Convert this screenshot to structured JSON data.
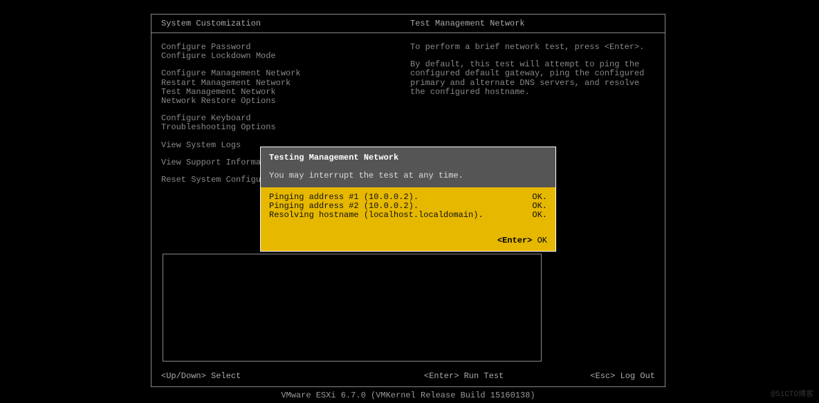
{
  "header": {
    "left": "System Customization",
    "right": "Test Management Network"
  },
  "menu": {
    "group1": [
      "Configure Password",
      "Configure Lockdown Mode"
    ],
    "group2": [
      "Configure Management Network",
      "Restart Management Network",
      "Test Management Network",
      "Network Restore Options"
    ],
    "group3": [
      "Configure Keyboard",
      "Troubleshooting Options"
    ],
    "group4": [
      "View System Logs"
    ],
    "group5": [
      "View Support Information"
    ],
    "group6": [
      "Reset System Configuration"
    ]
  },
  "description": {
    "p1": "To perform a brief network test, press <Enter>.",
    "p2": "By default, this test will attempt to ping the configured default gateway, ping the configured primary and alternate DNS servers, and resolve the configured hostname."
  },
  "dialog": {
    "title": "Testing Management Network",
    "subtitle": "You may interrupt the test at any time.",
    "results": [
      {
        "label": "Pinging address #1 (10.0.0.2).",
        "status": "OK."
      },
      {
        "label": "Pinging address #2 (10.0.0.2).",
        "status": "OK."
      },
      {
        "label": "Resolving hostname (localhost.localdomain).",
        "status": "OK."
      }
    ],
    "footer_key": "<Enter>",
    "footer_action": "OK"
  },
  "footer": {
    "left": "<Up/Down> Select",
    "center": "<Enter> Run Test",
    "right": "<Esc> Log Out"
  },
  "version": "VMware ESXi 6.7.0 (VMKernel Release Build 15160138)",
  "watermark": "@51CTO博客"
}
